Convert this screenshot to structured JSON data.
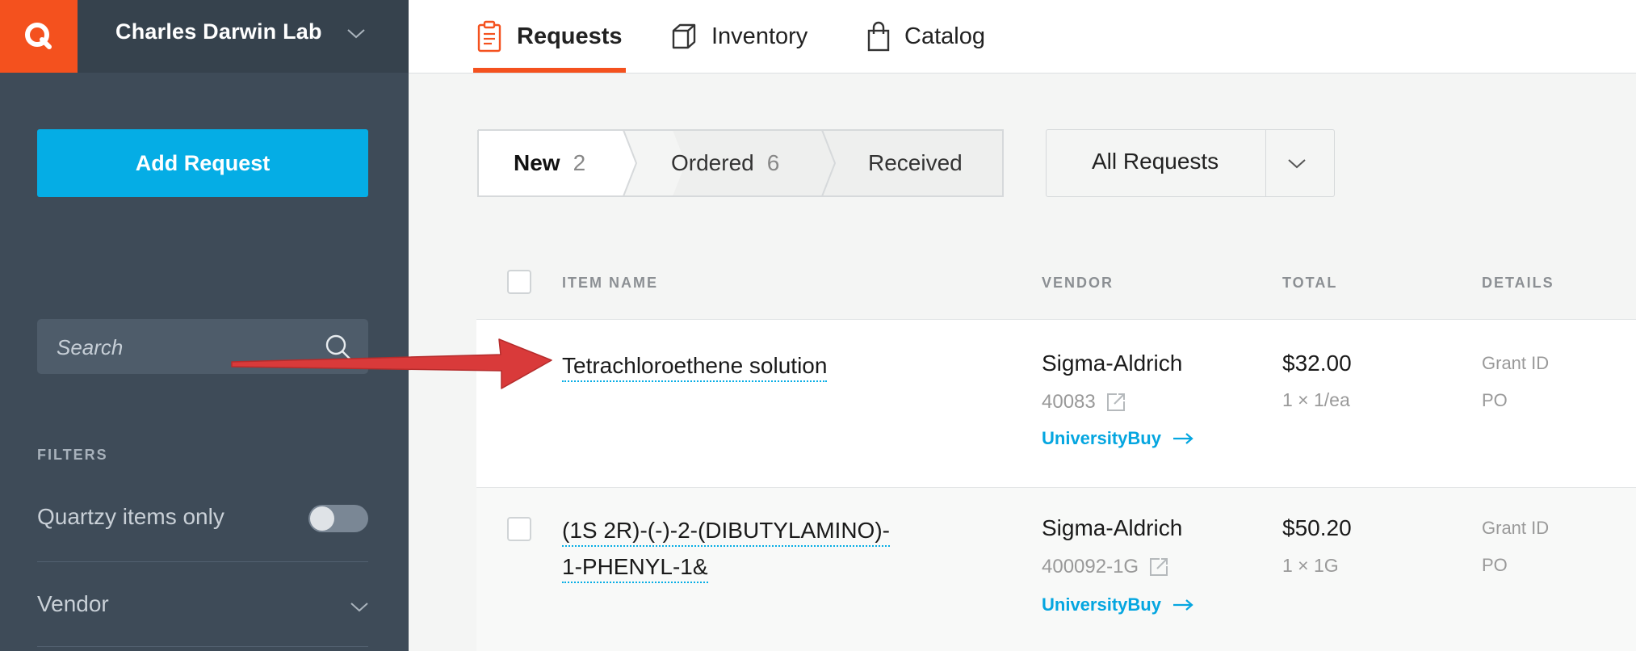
{
  "lab": {
    "name": "Charles Darwin Lab"
  },
  "sidebar": {
    "add_button": "Add Request",
    "search_placeholder": "Search",
    "filters_label": "FILTERS",
    "quartzy_only_label": "Quartzy items only",
    "quartzy_only_enabled": false,
    "vendor_filter_label": "Vendor"
  },
  "nav": {
    "tabs": [
      {
        "label": "Requests",
        "icon": "clipboard-icon",
        "active": true
      },
      {
        "label": "Inventory",
        "icon": "box-icon",
        "active": false
      },
      {
        "label": "Catalog",
        "icon": "shopping-bag-icon",
        "active": false
      }
    ]
  },
  "status_tabs": [
    {
      "label": "New",
      "count": "2",
      "active": true
    },
    {
      "label": "Ordered",
      "count": "6",
      "active": false
    },
    {
      "label": "Received",
      "count": "",
      "active": false
    }
  ],
  "request_filter": {
    "selected": "All Requests"
  },
  "table": {
    "columns": [
      "ITEM NAME",
      "VENDOR",
      "TOTAL",
      "DETAILS"
    ],
    "rows": [
      {
        "name_lines": [
          "Tetrachloroethene solution"
        ],
        "vendor": "Sigma-Aldrich",
        "catalog_no": "40083",
        "purchase_link": "UniversityBuy",
        "total": "$32.00",
        "quantity": "1 × 1/ea",
        "details": [
          "Grant ID",
          "PO"
        ]
      },
      {
        "name_lines": [
          "(1S 2R)-(-)-2-(DIBUTYLAMINO)-",
          "1-PHENYL-1&"
        ],
        "vendor": "Sigma-Aldrich",
        "catalog_no": "400092-1G",
        "purchase_link": "UniversityBuy",
        "total": "$50.20",
        "quantity": "1 × 1G",
        "details": [
          "Grant ID",
          "PO"
        ]
      }
    ]
  },
  "colors": {
    "brand_orange": "#f4511e",
    "accent_blue": "#05ade5",
    "sidebar_bg": "#3e4b58",
    "annotation_arrow": "#d93a3a"
  }
}
